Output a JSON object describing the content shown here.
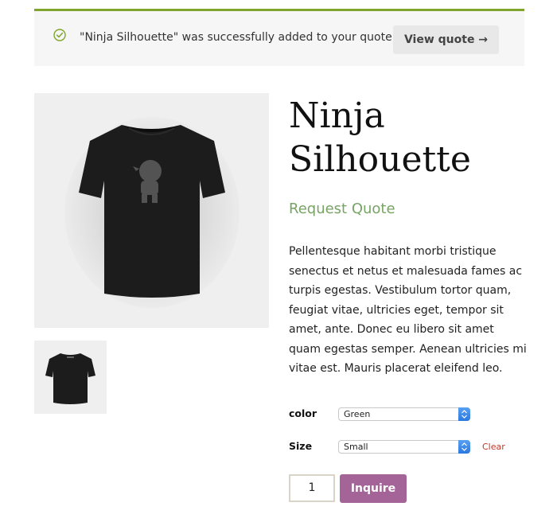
{
  "notice": {
    "message": "\"Ninja Silhouette\" was successfully added to your quote.",
    "view_quote_label": "View quote →"
  },
  "product": {
    "title": "Ninja Silhouette",
    "price_label": "Request Quote",
    "description": "Pellentesque habitant morbi tristique senectus et netus et malesuada fames ac turpis egestas. Vestibulum tortor quam, feugiat vitae, ultricies eget, tempor sit amet, ante. Donec eu libero sit amet quam egestas semper. Aenean ultricies mi vitae est. Mauris placerat eleifend leo."
  },
  "variations": {
    "color_label": "color",
    "color_value": "Green",
    "size_label": "Size",
    "size_value": "Small",
    "clear_label": "Clear"
  },
  "cart": {
    "quantity": "1",
    "submit_label": "Inquire"
  },
  "colors": {
    "notice_accent": "#7fa52e",
    "price": "#77a464",
    "inquire_button": "#a46497",
    "clear_link": "#c0392b"
  }
}
